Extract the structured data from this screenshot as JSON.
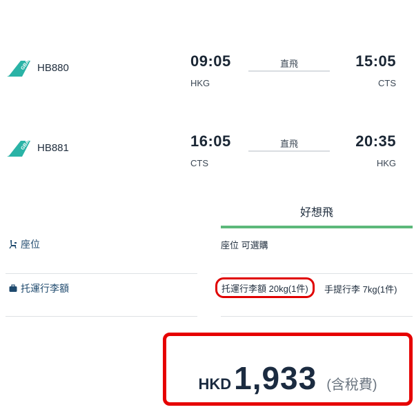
{
  "flights": [
    {
      "icon": "gba-tail-icon",
      "flight_no": "HB880",
      "dep_time": "09:05",
      "dep_code": "HKG",
      "stop_label": "直飛",
      "arr_time": "15:05",
      "arr_code": "CTS"
    },
    {
      "icon": "gba-tail-icon",
      "flight_no": "HB881",
      "dep_time": "16:05",
      "dep_code": "CTS",
      "stop_label": "直飛",
      "arr_time": "20:35",
      "arr_code": "HKG"
    }
  ],
  "fare": {
    "plan_name": "好想飛",
    "plan_color": "#5cb87a"
  },
  "features": {
    "seat_label": "座位",
    "seat_icon": "seat-icon",
    "seat_value": "座位 可選購",
    "baggage_label": "托運行李額",
    "baggage_icon": "suitcase-icon",
    "checked_baggage": "托運行李額 20kg(1件)",
    "hand_baggage": "手提行李 7kg(1件)"
  },
  "price": {
    "currency": "HKD",
    "amount": "1,933",
    "tax_note": "(含稅費)"
  },
  "colors": {
    "brand_teal": "#2ab3a6",
    "highlight_red": "#e60000",
    "label_blue": "#1f4a6e"
  }
}
